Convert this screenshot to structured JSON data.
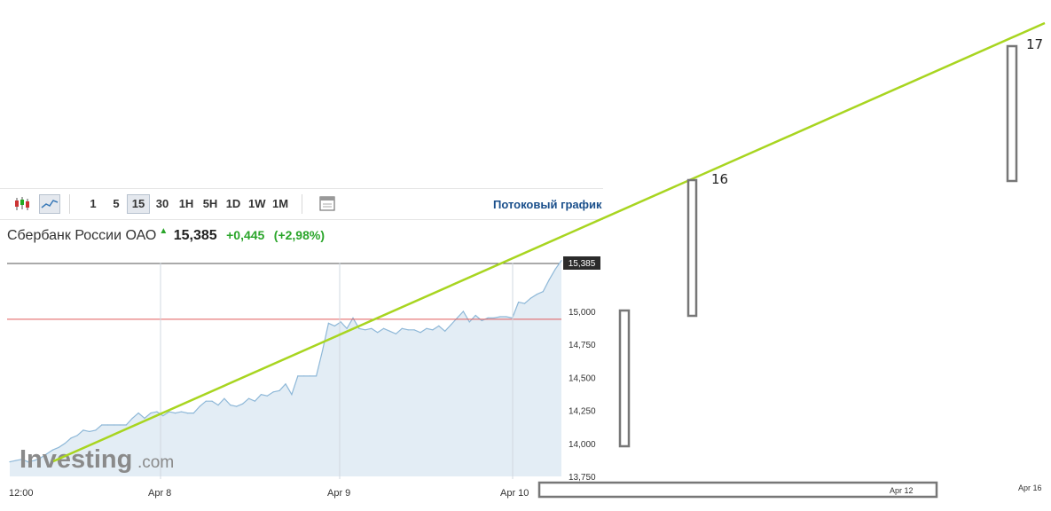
{
  "toolbar": {
    "intervals": [
      "1",
      "5",
      "15",
      "30",
      "1H",
      "5H",
      "1D",
      "1W",
      "1M"
    ],
    "active_interval": "15",
    "stream_label": "Потоковый график",
    "icons": [
      "candlestick-icon",
      "line-chart-icon",
      "calendar-icon"
    ]
  },
  "quote": {
    "name": "Сбербанк России ОАО",
    "price": "15,385",
    "change": "+0,445",
    "change_pct": "(+2,98%)",
    "direction": "up"
  },
  "colors": {
    "trendline": "#a8d520",
    "area_line": "#8eb8d8",
    "area_fill": "#e3edf5",
    "ref_line": "#e05a5a",
    "up": "#2aa52a",
    "price_box": "#2b2b2b"
  },
  "watermark": {
    "text": "Investing",
    "suffix": ".com"
  },
  "chart_data": {
    "type": "area",
    "x_tick_labels": [
      "12:00",
      "Apr 8",
      "Apr 9",
      "Apr 10"
    ],
    "y_tick_labels": [
      "15,000",
      "14,750",
      "14,500",
      "14,250",
      "14,000",
      "13,750"
    ],
    "ylim": [
      13.74,
      15.4
    ],
    "current_price_label": "15,385",
    "reference_line": 14.94,
    "values": [
      13.86,
      13.87,
      13.88,
      13.86,
      13.87,
      13.89,
      13.92,
      13.95,
      13.97,
      14.0,
      14.04,
      14.06,
      14.1,
      14.09,
      14.1,
      14.14,
      14.14,
      14.14,
      14.14,
      14.14,
      14.19,
      14.23,
      14.19,
      14.23,
      14.24,
      14.21,
      14.24,
      14.23,
      14.24,
      14.23,
      14.23,
      14.28,
      14.32,
      14.32,
      14.29,
      14.34,
      14.29,
      14.28,
      14.3,
      14.34,
      14.32,
      14.37,
      14.36,
      14.39,
      14.4,
      14.45,
      14.37,
      14.51,
      14.51,
      14.51,
      14.51,
      14.7,
      14.91,
      14.89,
      14.92,
      14.87,
      14.95,
      14.87,
      14.86,
      14.87,
      14.84,
      14.87,
      14.85,
      14.83,
      14.87,
      14.86,
      14.86,
      14.84,
      14.87,
      14.86,
      14.89,
      14.85,
      14.9,
      14.95,
      15.0,
      14.92,
      14.97,
      14.93,
      14.95,
      14.95,
      14.96,
      14.96,
      14.95,
      15.07,
      15.06,
      15.1,
      15.13,
      15.15,
      15.24,
      15.32,
      15.385
    ],
    "series": [
      {
        "values": "values"
      }
    ],
    "trendline": {
      "anchors": [
        {
          "label": "16",
          "level": 16
        },
        {
          "label": "17",
          "level": 17
        }
      ]
    },
    "overlay_axis": {
      "x_tick_labels": [
        "Apr 12",
        "Apr 16"
      ]
    },
    "grid": false,
    "legend": "none"
  }
}
